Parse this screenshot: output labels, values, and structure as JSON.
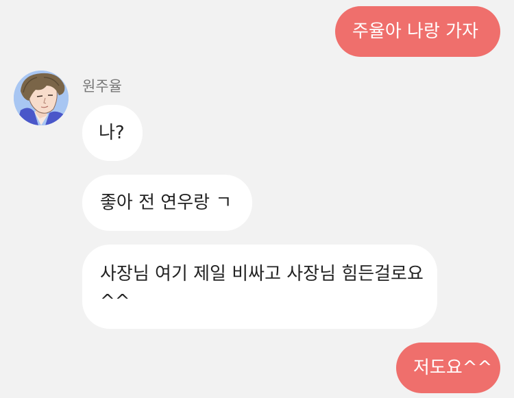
{
  "conversation": {
    "contact_name": "원주율",
    "messages": [
      {
        "side": "outgoing",
        "text": "주율아 나랑 가자"
      },
      {
        "side": "incoming",
        "text": "나?"
      },
      {
        "side": "incoming",
        "text": "좋아 전 연우랑 ㄱ"
      },
      {
        "side": "incoming",
        "text": "사장님 여기 제일 비싸고 사장님 힘든걸로요^^"
      },
      {
        "side": "outgoing",
        "text": "저도요^^"
      }
    ]
  },
  "colors": {
    "background": "#f2f2f2",
    "outgoing_bubble": "#ef6f6c",
    "incoming_bubble": "#ffffff"
  }
}
